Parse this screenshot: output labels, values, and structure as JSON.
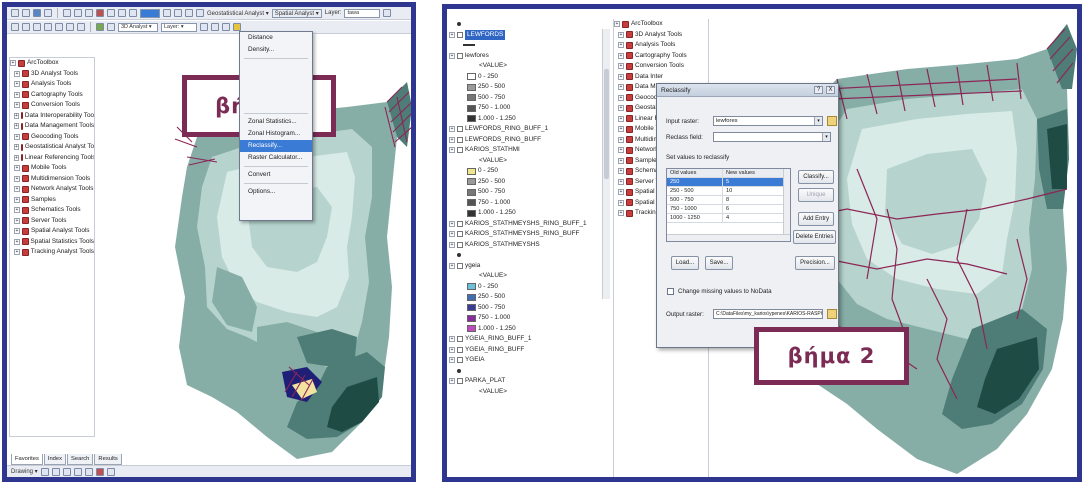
{
  "colors": {
    "frame": "#2e3690",
    "step_border": "#7b2b54",
    "selection": "#3a7bd5",
    "map_lightest": "#d9ebe6",
    "map_light": "#b6d4cd",
    "map_mid": "#86aea7",
    "map_dark": "#4d7d76",
    "map_darkest": "#1e4b44",
    "roads": "#8c2656",
    "parcel_navy": "#1f1f78"
  },
  "left": {
    "toolbar1": {
      "scale_combo": "",
      "geo_menu": "Geostatistical Analyst ▾",
      "spatial_menu": "Spatial Analyst ▾",
      "layer_label": "Layer:",
      "layer_value": "tawa"
    },
    "toolbar2": {
      "combo_a": "3D Analyst ▾",
      "combo_b": "Layer: ▾"
    },
    "toolbox": {
      "items": [
        "ArcToolbox",
        "3D Analyst Tools",
        "Analysis Tools",
        "Cartography Tools",
        "Conversion Tools",
        "Data Interoperability Tools",
        "Data Management Tools",
        "Geocoding Tools",
        "Geostatistical Analyst Tools",
        "Linear Referencing Tools",
        "Mobile Tools",
        "Multidimension Tools",
        "Network Analyst Tools",
        "Samples",
        "Schematics Tools",
        "Server Tools",
        "Spatial Analyst Tools",
        "Spatial Statistics Tools",
        "Tracking Analyst Tools"
      ]
    },
    "menu": {
      "items": [
        "Distance",
        "Density...",
        "",
        "",
        "",
        "",
        "",
        "Zonal Statistics...",
        "Zonal Histogram...",
        "Reclassify...",
        "Raster Calculator...",
        "Convert",
        "Options..."
      ]
    },
    "step_label": "βήμα 1",
    "tabs": [
      "Favorites",
      "Index",
      "Search",
      "Results"
    ],
    "drawing_toolbar": "Drawing ▾"
  },
  "right": {
    "toc": {
      "items": [
        {
          "kind": "dot",
          "text": ""
        },
        {
          "kind": "layer",
          "text": "LEWFORDS",
          "selected": true
        },
        {
          "kind": "line",
          "text": ""
        },
        {
          "kind": "layer",
          "text": "lewfores"
        },
        {
          "kind": "value",
          "text": "<VALUE>"
        },
        {
          "kind": "class",
          "text": "0 - 250",
          "swatch": "#ffffff"
        },
        {
          "kind": "class",
          "text": "250 - 500",
          "swatch": "#9a9a9a"
        },
        {
          "kind": "class",
          "text": "500 - 750",
          "swatch": "#777777"
        },
        {
          "kind": "class",
          "text": "750 - 1.000",
          "swatch": "#555555"
        },
        {
          "kind": "class",
          "text": "1.000 - 1.250",
          "swatch": "#333333"
        },
        {
          "kind": "layer",
          "text": "LEWFORDS_RING_BUFF_1"
        },
        {
          "kind": "layer",
          "text": "LEWFORDS_RING_BUFF"
        },
        {
          "kind": "layer",
          "text": "KARIOS_STATHMI"
        },
        {
          "kind": "value",
          "text": "<VALUE>"
        },
        {
          "kind": "class",
          "text": "0 - 250",
          "swatch": "#f0e68c"
        },
        {
          "kind": "class",
          "text": "250 - 500",
          "swatch": "#9a9a9a"
        },
        {
          "kind": "class",
          "text": "500 - 750",
          "swatch": "#777777"
        },
        {
          "kind": "class",
          "text": "750 - 1.000",
          "swatch": "#555555"
        },
        {
          "kind": "class",
          "text": "1.000 - 1.250",
          "swatch": "#333333"
        },
        {
          "kind": "layer",
          "text": "KARIOS_STATHMEYSHS_RING_BUFF_1"
        },
        {
          "kind": "layer",
          "text": "KARIOS_STATHMEYSHS_RING_BUFF"
        },
        {
          "kind": "layer",
          "text": "KARIOS_STATHMEYSHS"
        },
        {
          "kind": "dot",
          "text": ""
        },
        {
          "kind": "layer",
          "text": "ygeia"
        },
        {
          "kind": "value",
          "text": "<VALUE>"
        },
        {
          "kind": "class",
          "text": "0 - 250",
          "swatch": "#6cc0d8"
        },
        {
          "kind": "class",
          "text": "250 - 500",
          "swatch": "#3f6fb0"
        },
        {
          "kind": "class",
          "text": "500 - 750",
          "swatch": "#3b3b98"
        },
        {
          "kind": "class",
          "text": "750 - 1.000",
          "swatch": "#8a2c9c"
        },
        {
          "kind": "class",
          "text": "1.000 - 1.250",
          "swatch": "#c04bbf"
        },
        {
          "kind": "layer",
          "text": "YGEIA_RING_BUFF_1"
        },
        {
          "kind": "layer",
          "text": "YGEIA_RING_BUFF"
        },
        {
          "kind": "layer",
          "text": "YGEIA"
        },
        {
          "kind": "dot",
          "text": ""
        },
        {
          "kind": "layer",
          "text": "PARKA_PLAT"
        },
        {
          "kind": "value",
          "text": "<VALUE>"
        }
      ]
    },
    "toolbox": {
      "items": [
        "ArcToolbox",
        "3D Analyst Tools",
        "Analysis Tools",
        "Cartography Tools",
        "Conversion Tools",
        "Data Inter",
        "Data Mana",
        "Geocodin",
        "Geostatisti",
        "Linear Ref",
        "Mobile To",
        "Multidime",
        "Network A",
        "Samples",
        "Schemati",
        "Server To",
        "Spatial An",
        "Spatial St",
        "Tracking A"
      ]
    },
    "dialog": {
      "title": "Reclassify",
      "help_btn": "?",
      "close_btn": "X",
      "input_label": "Input raster:",
      "input_value": "lewfores",
      "field_label": "Reclass field:",
      "field_value": "",
      "set_values_label": "Set values to reclassify",
      "table_headers": [
        "Old values",
        "New values"
      ],
      "table_rows": [
        [
          "250",
          "5"
        ],
        [
          "250 - 500",
          "10"
        ],
        [
          "500 - 750",
          "8"
        ],
        [
          "750 - 1000",
          "6"
        ],
        [
          "1000 - 1250",
          "4"
        ]
      ],
      "btn_classify": "Classify...",
      "btn_unique": "Unique",
      "btn_add_entry": "Add Entry",
      "btn_delete_entries": "Delete Entries",
      "btn_load": "Load...",
      "btn_save": "Save...",
      "btn_precision": "Precision...",
      "nodata_label": "Change missing values to NoData",
      "output_label": "Output raster:",
      "output_value": "C:\\DataFiles\\my_karios\\ypenes\\KARIOS-RASPORT"
    },
    "step_label": "βήμα 2"
  }
}
